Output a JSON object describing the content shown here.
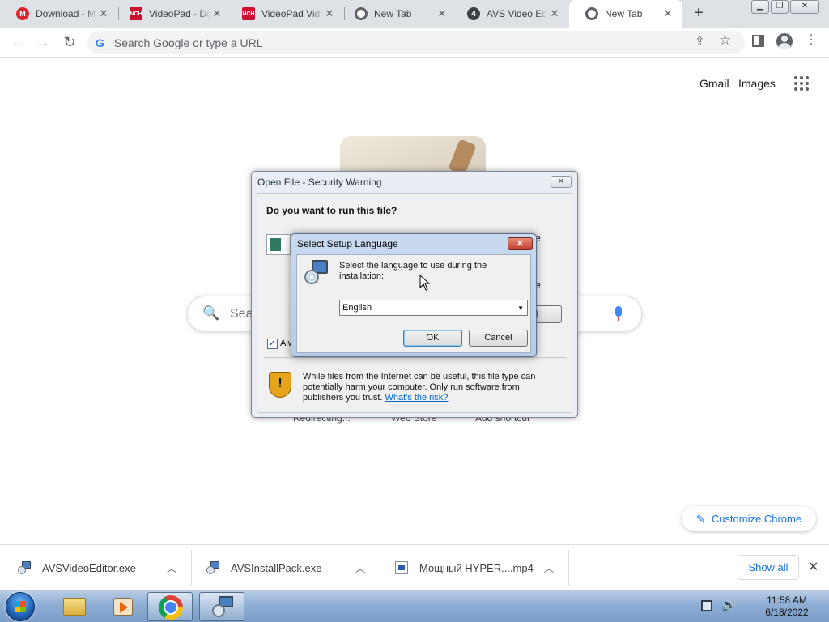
{
  "browser": {
    "tabs": [
      {
        "title": "Download - M",
        "favicon": "mega-icon",
        "color": "#d9272e",
        "active": false
      },
      {
        "title": "VideoPad - Do",
        "favicon": "nch-icon",
        "color": "#c8102e",
        "active": false
      },
      {
        "title": "VideoPad Vid",
        "favicon": "nch-icon",
        "color": "#c8102e",
        "active": false
      },
      {
        "title": "New Tab",
        "favicon": "chrome-icon",
        "color": "#5f6368",
        "active": false
      },
      {
        "title": "AVS Video Ed",
        "favicon": "avs-icon",
        "color": "#3c4043",
        "active": false
      },
      {
        "title": "New Tab",
        "favicon": "chrome-icon",
        "color": "#5f6368",
        "active": true
      }
    ],
    "omnibox_placeholder": "Search Google or type a URL"
  },
  "ntp": {
    "gmail": "Gmail",
    "images": "Images",
    "search_placeholder": "Sea",
    "shortcuts": [
      "Redirecting...",
      "Web Store",
      "Add shortcut"
    ],
    "customize": "Customize Chrome"
  },
  "security_dialog": {
    "title": "Open File - Security Warning",
    "heading": "Do you want to run this file?",
    "partial_button": "el",
    "partial_chars": [
      "e",
      "e"
    ],
    "checkbox_label": "Alw",
    "checkbox_checked": true,
    "warning_text": "While files from the Internet can be useful, this file type can potentially harm your computer. Only run software from publishers you trust.",
    "risk_link": "What's the risk?"
  },
  "setup_dialog": {
    "title": "Select Setup Language",
    "prompt": "Select the language to use during the installation:",
    "language": "English",
    "ok": "OK",
    "cancel": "Cancel"
  },
  "downloads": {
    "items": [
      {
        "name": "AVSVideoEditor.exe",
        "icon": "installer-icon"
      },
      {
        "name": "AVSInstallPack.exe",
        "icon": "installer-icon"
      },
      {
        "name": "Мощный HYPER....mp4",
        "icon": "video-file-icon"
      }
    ],
    "show_all": "Show all"
  },
  "taskbar": {
    "time": "11:58 AM",
    "date": "6/18/2022"
  }
}
